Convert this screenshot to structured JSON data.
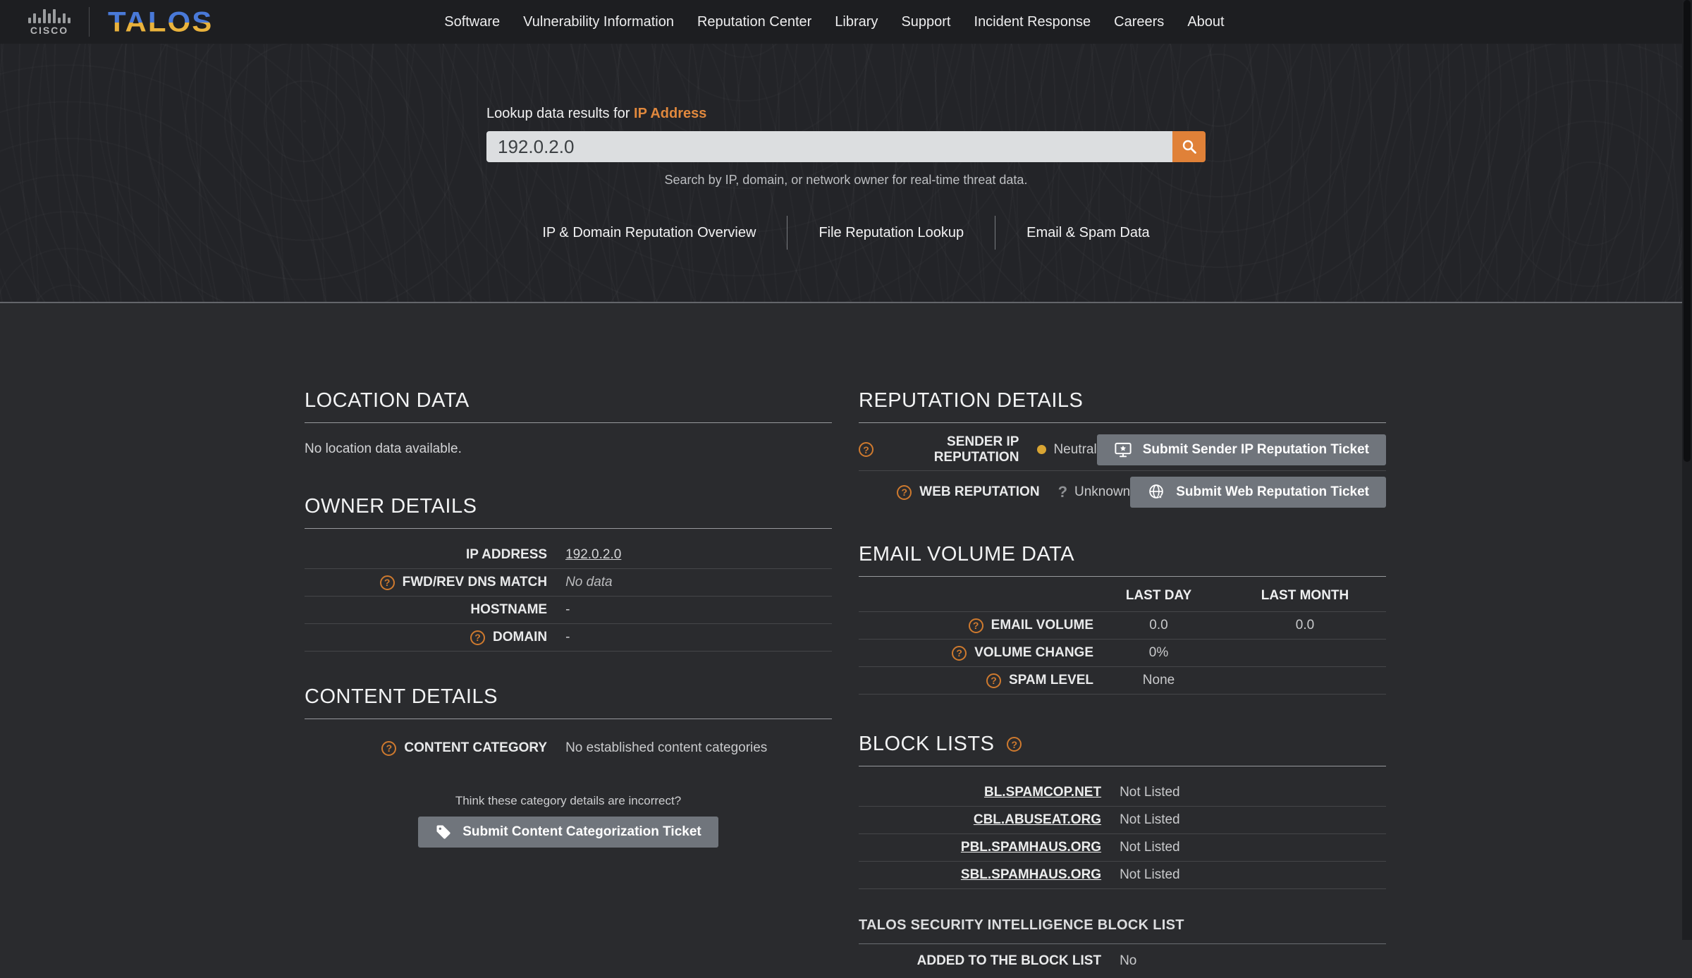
{
  "nav": {
    "brand": {
      "cisco_label": "CISCO",
      "talos_label": "TALOS"
    },
    "items": [
      "Software",
      "Vulnerability Information",
      "Reputation Center",
      "Library",
      "Support",
      "Incident Response",
      "Careers",
      "About"
    ]
  },
  "search": {
    "label_prefix": "Lookup data results for ",
    "label_highlight": "IP Address",
    "value": "192.0.2.0",
    "hint": "Search by IP, domain, or network owner for real-time threat data."
  },
  "tabs": [
    "IP & Domain Reputation Overview",
    "File Reputation Lookup",
    "Email & Spam Data"
  ],
  "location_data": {
    "title": "LOCATION DATA",
    "empty_message": "No location data available."
  },
  "owner_details": {
    "title": "OWNER DETAILS",
    "rows": [
      {
        "label": "IP ADDRESS",
        "value": "192.0.2.0"
      },
      {
        "label": "FWD/REV DNS MATCH",
        "value": "No data"
      },
      {
        "label": "HOSTNAME",
        "value": "-"
      },
      {
        "label": "DOMAIN",
        "value": "-"
      }
    ]
  },
  "content_details": {
    "title": "CONTENT DETAILS",
    "category_label": "CONTENT CATEGORY",
    "category_value": "No established content categories",
    "prompt": "Think these category details are incorrect?",
    "button_label": "Submit Content Categorization Ticket"
  },
  "reputation_details": {
    "title": "REPUTATION DETAILS",
    "rows": [
      {
        "label": "SENDER IP REPUTATION",
        "status": "Neutral",
        "button_label": "Submit Sender IP Reputation Ticket"
      },
      {
        "label": "WEB REPUTATION",
        "status": "Unknown",
        "button_label": "Submit Web Reputation Ticket"
      }
    ]
  },
  "email_volume": {
    "title": "EMAIL VOLUME DATA",
    "columns": [
      "LAST DAY",
      "LAST MONTH"
    ],
    "rows": [
      {
        "label": "EMAIL VOLUME",
        "values": [
          "0.0",
          "0.0"
        ]
      },
      {
        "label": "VOLUME CHANGE",
        "values": [
          "0%",
          ""
        ]
      },
      {
        "label": "SPAM LEVEL",
        "values": [
          "None",
          ""
        ]
      }
    ]
  },
  "block_lists": {
    "title": "BLOCK LISTS",
    "rows": [
      {
        "name": "BL.SPAMCOP.NET",
        "status": "Not Listed"
      },
      {
        "name": "CBL.ABUSEAT.ORG",
        "status": "Not Listed"
      },
      {
        "name": "PBL.SPAMHAUS.ORG",
        "status": "Not Listed"
      },
      {
        "name": "SBL.SPAMHAUS.ORG",
        "status": "Not Listed"
      }
    ]
  },
  "talos_block_list": {
    "title": "TALOS SECURITY INTELLIGENCE BLOCK LIST",
    "row": {
      "label": "ADDED TO THE BLOCK LIST",
      "value": "No"
    }
  },
  "colors": {
    "accent_orange": "#e08138",
    "highlight_orange": "#e0883d",
    "button_gray": "#70757c",
    "neutral_dot_gold": "#d9a533",
    "nav_bg": "#1d1e21",
    "hero_bg": "#232428",
    "content_bg": "#2a2b2e"
  }
}
